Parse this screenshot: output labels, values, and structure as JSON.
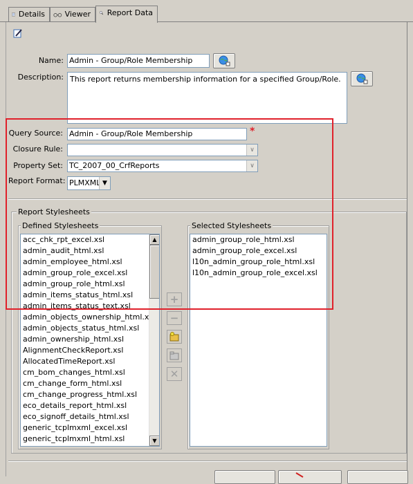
{
  "tabs": [
    {
      "label": "Details",
      "icon": "details-icon"
    },
    {
      "label": "Viewer",
      "icon": "glasses-icon"
    },
    {
      "label": "Report Data",
      "icon": "magnifier-icon",
      "active": true
    }
  ],
  "form": {
    "name_label": "Name:",
    "name_value": "Admin - Group/Role Membership",
    "description_label": "Description:",
    "description_value": "This report returns membership information for a specified Group/Role.",
    "query_source_label": "Query Source:",
    "query_source_value": "Admin - Group/Role Membership",
    "required_marker": "*",
    "closure_rule_label": "Closure Rule:",
    "closure_rule_value": "",
    "property_set_label": "Property Set:",
    "property_set_value": "TC_2007_00_CrfReports",
    "report_format_label": "Report Format:",
    "report_format_value": "PLMXML"
  },
  "stylesheets": {
    "group_title": "Report Stylesheets",
    "defined_title": "Defined Stylesheets",
    "selected_title": "Selected Stylesheets",
    "defined": [
      "acc_chk_rpt_excel.xsl",
      "admin_audit_html.xsl",
      "admin_employee_html.xsl",
      "admin_group_role_excel.xsl",
      "admin_group_role_html.xsl",
      "admin_items_status_html.xsl",
      "admin_items_status_text.xsl",
      "admin_objects_ownership_html.xsl",
      "admin_objects_status_html.xsl",
      "admin_ownership_html.xsl",
      "AlignmentCheckReport.xsl",
      "AllocatedTimeReport.xsl",
      "cm_bom_changes_html.xsl",
      "cm_change_form_html.xsl",
      "cm_change_progress_html.xsl",
      "eco_details_report_html.xsl",
      "eco_signoff_details_html.xsl",
      "generic_tcplmxml_excel.xsl",
      "generic_tcplmxml_html.xsl"
    ],
    "selected": [
      "admin_group_role_html.xsl",
      "admin_group_role_excel.xsl",
      "l10n_admin_group_role_html.xsl",
      "l10n_admin_group_role_excel.xsl"
    ]
  },
  "colors": {
    "highlight_box": "#e0202a",
    "background": "#d4d0c8"
  }
}
